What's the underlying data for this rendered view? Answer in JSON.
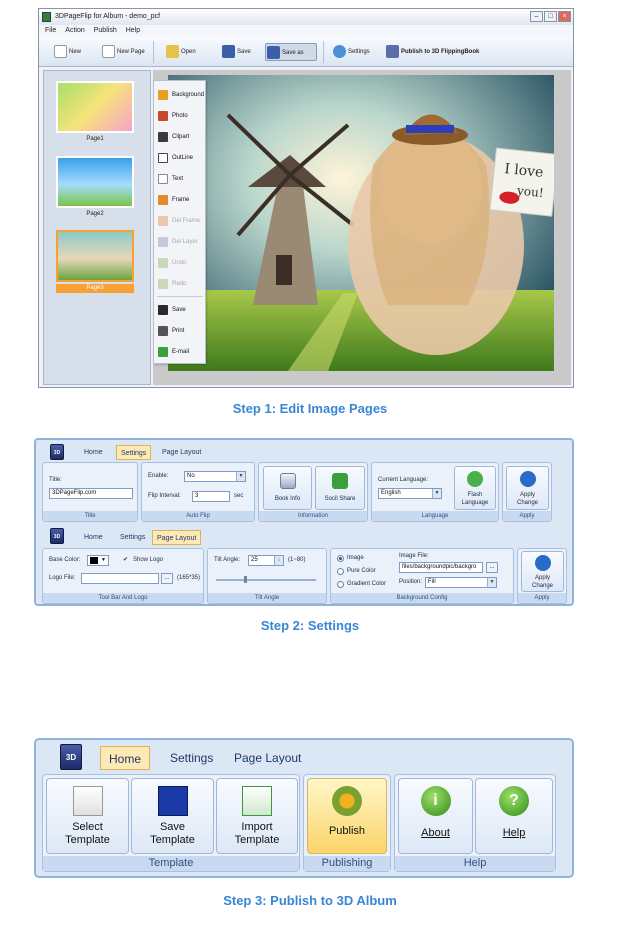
{
  "step1": {
    "window_title": "3DPageFlip for Album - demo_pcf",
    "menu": [
      "File",
      "Action",
      "Publish",
      "Help"
    ],
    "toolbar": {
      "new": "New",
      "new_page": "New Page",
      "open": "Open",
      "save": "Save",
      "save_as": "Save as",
      "settings": "Settings",
      "publish": "Publish to 3D FlippingBook"
    },
    "pages": [
      "Page1",
      "Page2",
      "Page3"
    ],
    "side_menu": {
      "background": "Background",
      "photo": "Photo",
      "clipart": "Clipart",
      "outline": "OutLine",
      "text": "Text",
      "frame": "Frame",
      "del_frame": "Del Frame",
      "del_layer": "Del Layer",
      "undo": "Undo",
      "redo": "Redo",
      "save": "Save",
      "print": "Print",
      "email": "E-mail"
    },
    "photo_note_line1": "I love",
    "photo_note_line2": "you!",
    "caption": "Step 1: Edit Image Pages"
  },
  "step2": {
    "top": {
      "tabs": {
        "home": "Home",
        "settings": "Settings",
        "page_layout": "Page Layout"
      },
      "title_label": "Title:",
      "title_value": "3DPageFlip.com",
      "enable_label": "Enable:",
      "enable_value": "No",
      "flip_interval_label": "Flip Interval:",
      "flip_interval_value": "3",
      "flip_interval_unit": "sec",
      "book_info": "Book Info",
      "social_share": "Socil Share",
      "current_language_label": "Current Language:",
      "language_value": "English",
      "flash_language_line1": "Flash",
      "flash_language_line2": "Language",
      "apply_change_line1": "Apply",
      "apply_change_line2": "Change",
      "groups": {
        "title": "Title",
        "auto_flip": "Auto Flip",
        "information": "Information",
        "language": "Language",
        "apply": "Apply"
      }
    },
    "bottom": {
      "tabs": {
        "home": "Home",
        "settings": "Settings",
        "page_layout": "Page Layout"
      },
      "base_color_label": "Base Color:",
      "show_logo": "Show Logo",
      "logo_file_label": "Logo File:",
      "logo_browse": "...",
      "logo_size": "(165*35)",
      "tilt_angle_label": "Tilt Angle:",
      "tilt_angle_value": "25",
      "tilt_range": "(1~80)",
      "radio_image": "Image",
      "radio_pure_color": "Pure Color",
      "radio_gradient": "Gradient Color",
      "image_file_label": "Image File:",
      "image_file_value": "files/backgroundpic/backgro",
      "image_browse": "...",
      "position_label": "Position:",
      "position_value": "Fill",
      "apply_change_line1": "Apply",
      "apply_change_line2": "Change",
      "groups": {
        "toolbar_logo": "Tool Bar And Logo",
        "tilt_angle": "Tilt Angle",
        "background_config": "Background Config",
        "apply": "Apply"
      }
    },
    "caption": "Step 2: Settings"
  },
  "step3": {
    "tabs": {
      "home": "Home",
      "settings": "Settings",
      "page_layout": "Page Layout"
    },
    "select_template_line1": "Select",
    "select_template_line2": "Template",
    "save_template_line1": "Save",
    "save_template_line2": "Template",
    "import_template_line1": "Import",
    "import_template_line2": "Template",
    "publish": "Publish",
    "about": "About",
    "help": "Help",
    "groups": {
      "template": "Template",
      "publishing": "Publishing",
      "help": "Help"
    },
    "caption": "Step 3: Publish to 3D Album"
  },
  "logo_text": "3D",
  "colors": {
    "accent": "#3a86d6",
    "selected": "#f7a034",
    "ribbon_active": "#fde9b5"
  }
}
